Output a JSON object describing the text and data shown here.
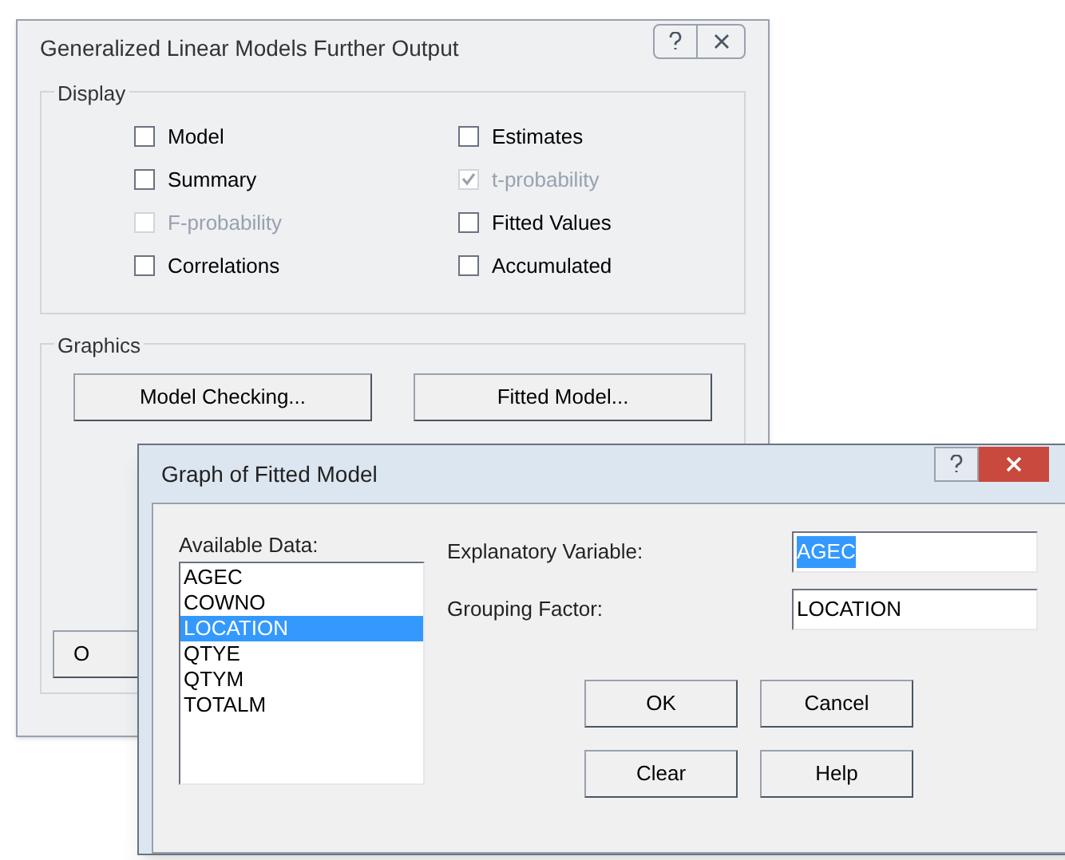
{
  "back_window": {
    "title": "Generalized Linear Models Further Output",
    "display": {
      "label": "Display",
      "options": [
        {
          "label": "Model",
          "checked": false,
          "disabled": false
        },
        {
          "label": "Estimates",
          "checked": false,
          "disabled": false
        },
        {
          "label": "Summary",
          "checked": false,
          "disabled": false
        },
        {
          "label": "t-probability",
          "checked": true,
          "disabled": true
        },
        {
          "label": "F-probability",
          "checked": false,
          "disabled": true
        },
        {
          "label": "Fitted Values",
          "checked": false,
          "disabled": false
        },
        {
          "label": "Correlations",
          "checked": false,
          "disabled": false
        },
        {
          "label": "Accumulated",
          "checked": false,
          "disabled": false
        }
      ]
    },
    "graphics": {
      "label": "Graphics",
      "buttons": [
        "Model Checking...",
        "Fitted Model..."
      ]
    },
    "bottom_button": "O"
  },
  "front_window": {
    "title": "Graph of Fitted Model",
    "list_label": "Available Data:",
    "items": [
      {
        "label": "AGEC",
        "selected": false
      },
      {
        "label": "COWNO",
        "selected": false
      },
      {
        "label": "LOCATION",
        "selected": true
      },
      {
        "label": "QTYE",
        "selected": false
      },
      {
        "label": "QTYM",
        "selected": false
      },
      {
        "label": "TOTALM",
        "selected": false
      }
    ],
    "fields": [
      {
        "label": "Explanatory Variable:",
        "value": "AGEC",
        "text_selected": true
      },
      {
        "label": "Grouping Factor:",
        "value": "LOCATION",
        "text_selected": false
      }
    ],
    "buttons": [
      "OK",
      "Cancel",
      "Clear",
      "Help"
    ]
  }
}
